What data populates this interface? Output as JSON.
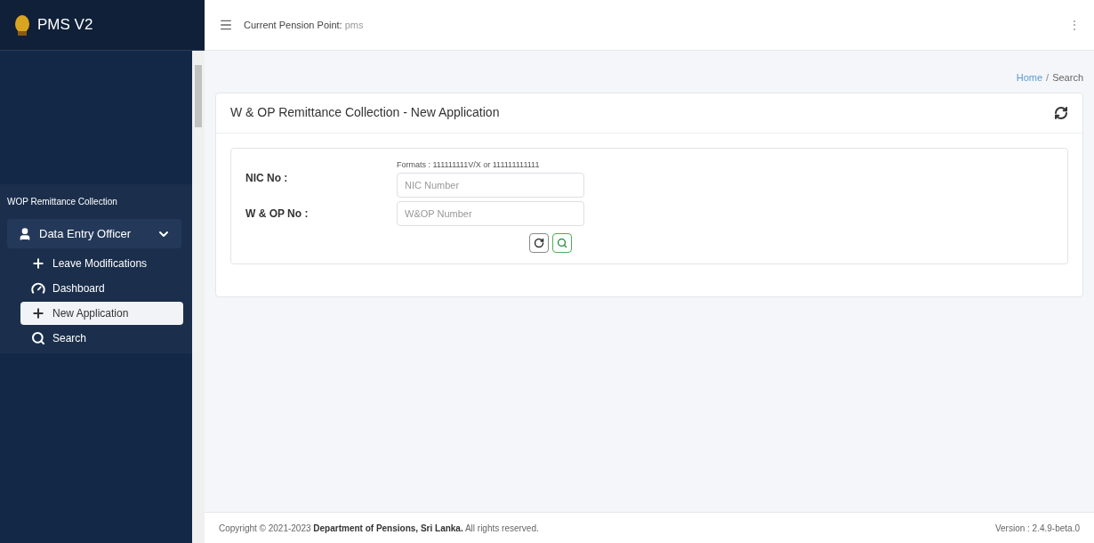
{
  "app": {
    "title": "PMS V2"
  },
  "sidebar": {
    "section": "WOP Remittance Collection",
    "group": {
      "label": "Data Entry Officer",
      "expanded": true,
      "items": [
        {
          "label": "Leave Modifications",
          "kind": "add",
          "selected": false
        },
        {
          "label": "Dashboard",
          "kind": "dashboard",
          "selected": false
        },
        {
          "label": "New Application",
          "kind": "add",
          "selected": true
        },
        {
          "label": "Search",
          "kind": "search",
          "selected": false
        }
      ]
    }
  },
  "topbar": {
    "label": "Current Pension Point:",
    "value": "pms",
    "menu": "⋮"
  },
  "breadcrumb": [
    "Home",
    "/",
    "Search"
  ],
  "card": {
    "title": "W & OP Remittance Collection - New Application",
    "fields": [
      {
        "label": "NIC No :",
        "hint": "Formats : 111111111V/X or 111111111111",
        "placeholder": "NIC Number"
      },
      {
        "label": "W & OP No :",
        "placeholder": "W&OP Number"
      }
    ]
  },
  "footer": {
    "copyright": "Copyright © 2021-2023 **Department of Pensions, Sri Lanka.** All rights reserved.",
    "version": "Version : 2.4.9-beta.0"
  }
}
